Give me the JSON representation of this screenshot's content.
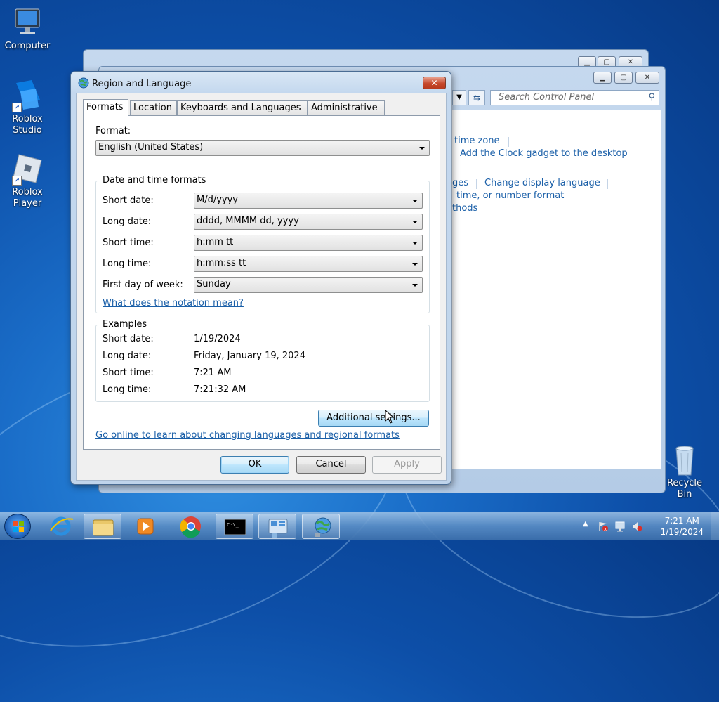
{
  "desktop": {
    "icons": [
      {
        "label": "Computer"
      },
      {
        "label": "Roblox Studio"
      },
      {
        "label": "Roblox Player"
      },
      {
        "label": "Recycle Bin"
      }
    ]
  },
  "control_panel": {
    "search_placeholder": "Search Control Panel",
    "links": {
      "time_zone": "time zone",
      "clock_gadget": "Add the Clock gadget to the desktop",
      "ges": "ges",
      "change_display_language": "Change display language",
      "number_format": "time, or number format",
      "methods": "thods"
    }
  },
  "dialog": {
    "title": "Region and Language",
    "tabs": [
      "Formats",
      "Location",
      "Keyboards and Languages",
      "Administrative"
    ],
    "format_label": "Format:",
    "format_value": "English (United States)",
    "date_time_group": "Date and time formats",
    "fields": [
      {
        "label": "Short date:",
        "value": "M/d/yyyy"
      },
      {
        "label": "Long date:",
        "value": "dddd, MMMM dd, yyyy"
      },
      {
        "label": "Short time:",
        "value": "h:mm tt"
      },
      {
        "label": "Long time:",
        "value": "h:mm:ss tt"
      },
      {
        "label": "First day of week:",
        "value": "Sunday"
      }
    ],
    "notation_link": "What does the notation mean?",
    "examples_group": "Examples",
    "examples": [
      {
        "label": "Short date:",
        "value": "1/19/2024"
      },
      {
        "label": "Long date:",
        "value": "Friday, January 19, 2024"
      },
      {
        "label": "Short time:",
        "value": "7:21 AM"
      },
      {
        "label": "Long time:",
        "value": "7:21:32 AM"
      }
    ],
    "additional_settings": "Additional settings...",
    "online_link": "Go online to learn about changing languages and regional formats",
    "ok": "OK",
    "cancel": "Cancel",
    "apply": "Apply",
    "close_glyph": "✕"
  },
  "taskbar": {
    "time": "7:21 AM",
    "date": "1/19/2024"
  }
}
